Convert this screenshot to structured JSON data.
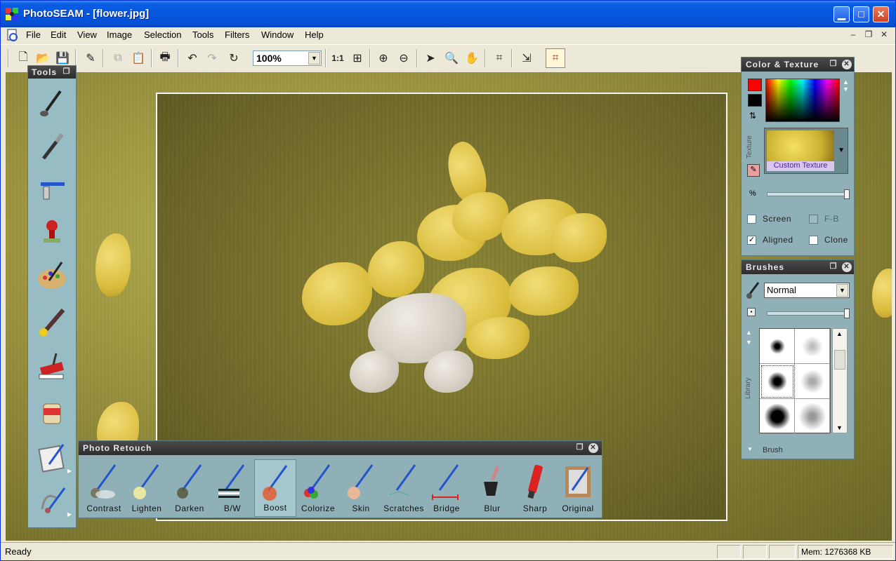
{
  "window": {
    "title": "PhotoSEAM - [flower.jpg]"
  },
  "menu": [
    "File",
    "Edit",
    "View",
    "Image",
    "Selection",
    "Tools",
    "Filters",
    "Window",
    "Help"
  ],
  "toolbar": {
    "zoom": "100%",
    "actual_size_label": "1:1",
    "icons": [
      "new-icon",
      "open-icon",
      "save-icon",
      "eraser-icon",
      "copy-icon",
      "paste-icon",
      "print-icon",
      "undo-icon",
      "redo-icon",
      "repeat-icon",
      "fit-icon",
      "zoom-in-icon",
      "zoom-out-icon",
      "pointer-icon",
      "magnifier-icon",
      "hand-icon",
      "crop-icon",
      "resize-icon",
      "seam-crop-icon"
    ]
  },
  "tools_panel": {
    "title": "Tools",
    "items": [
      "paint-brush-tool",
      "pen-tool",
      "airbrush-tool",
      "stamp-tool",
      "palette-tool",
      "smudge-brush-tool",
      "roller-tool",
      "paint-bucket-tool",
      "frame-tool",
      "retouch-tool"
    ]
  },
  "color_texture_panel": {
    "title": "Color & Texture",
    "foreground_color": "#ff0000",
    "background_color": "#000000",
    "texture_side_label": "Texture",
    "texture_name": "Custom Texture",
    "percent_label": "%",
    "checkboxes": [
      {
        "label": "Screen",
        "checked": false
      },
      {
        "label": "F-B",
        "checked": false
      },
      {
        "label": "Aligned",
        "checked": true
      },
      {
        "label": "Clone",
        "checked": false
      }
    ]
  },
  "brushes_panel": {
    "title": "Brushes",
    "mode": "Normal",
    "library_label": "Library",
    "footer": "Brush"
  },
  "retouch_panel": {
    "title": "Photo Retouch",
    "items": [
      "Contrast",
      "Lighten",
      "Darken",
      "B/W",
      "Boost",
      "Colorize",
      "Skin",
      "Scratches",
      "Bridge",
      "Blur",
      "Sharp",
      "Original"
    ],
    "selected": "Boost"
  },
  "status": {
    "text": "Ready",
    "memory": "Mem: 1276368 KB"
  }
}
